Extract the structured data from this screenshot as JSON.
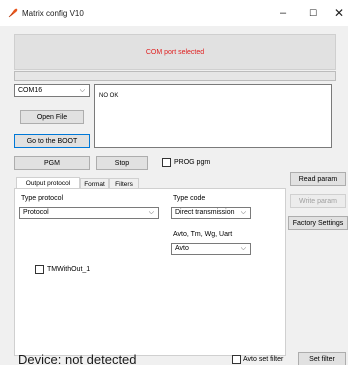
{
  "window": {
    "title": "Matrix config V10",
    "minimize_glyph": "–",
    "maximize_glyph": "☐",
    "close_glyph": "✕",
    "icon": "feather-app-icon"
  },
  "status": {
    "message": "COM port selected",
    "message_color": "#e02020",
    "progress_percent": 0
  },
  "port": {
    "selected": "COM16"
  },
  "log": {
    "text": "NO OK"
  },
  "buttons": {
    "open_file": "Open File",
    "go_boot": "Go to the BOOT",
    "pgm": "PGM",
    "stop": "Stop",
    "read_param": "Read param",
    "write_param": "Write param",
    "factory_settings": "Factory Settings",
    "set_filter": "Set filter"
  },
  "checks": {
    "prog_pgm": "PROG pgm",
    "tm_without": "TMWithOut_1",
    "avto_set_filter": "Avto set filter"
  },
  "tabs": [
    {
      "label": "Output protocol",
      "active": true
    },
    {
      "label": "Format",
      "active": false
    },
    {
      "label": "Filters",
      "active": false
    }
  ],
  "output_protocol": {
    "type_protocol_label": "Type protocol",
    "type_protocol_value": "Protocol",
    "type_code_label": "Type code",
    "type_code_value": "Direct transmission",
    "avto_label": "Avto, Tm, Wg, Uart",
    "avto_value": "Avto"
  },
  "device": {
    "status": "Device: not detected"
  },
  "colors": {
    "accent": "#0078d7",
    "progress": "#06b025"
  }
}
